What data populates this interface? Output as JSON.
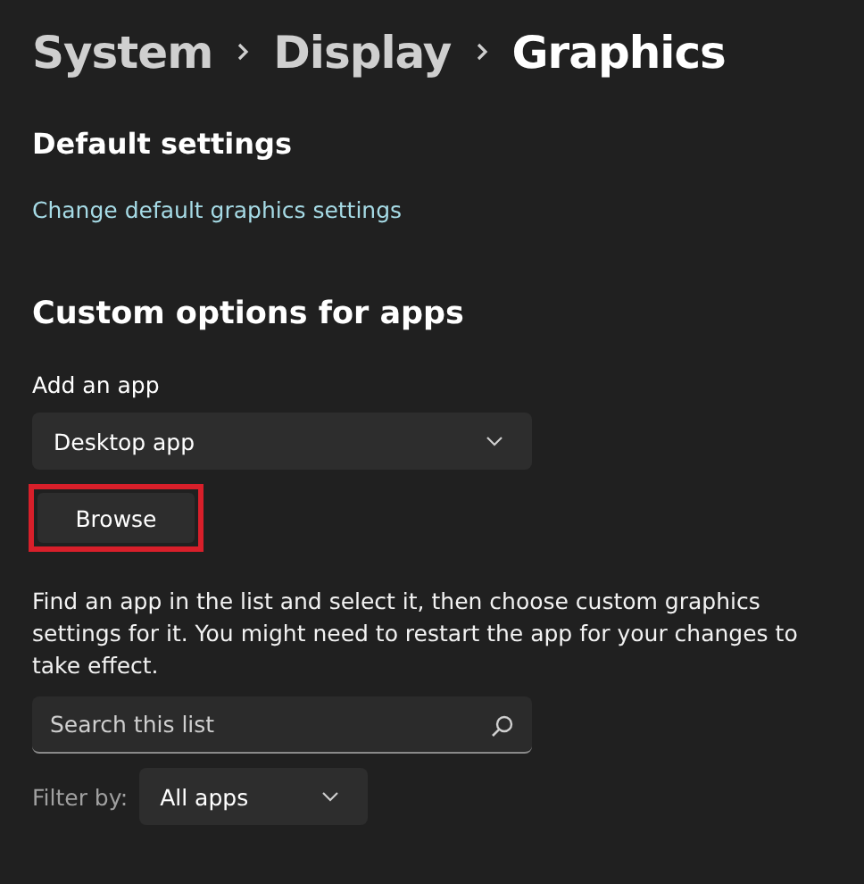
{
  "breadcrumb": [
    {
      "label": "System",
      "selected": false
    },
    {
      "label": "Display",
      "selected": false
    },
    {
      "label": "Graphics",
      "selected": true
    }
  ],
  "default_settings": {
    "heading": "Default settings",
    "link": "Change default graphics settings"
  },
  "custom_options": {
    "heading": "Custom options for apps",
    "add_label": "Add an app",
    "app_type": "Desktop app",
    "browse": {
      "label": "Browse",
      "highlighted": true
    },
    "description": "Find an app in the list and select it, then choose custom graphics settings for it. You might need to restart the app for your changes to take effect.",
    "search": {
      "placeholder": "Search this list"
    },
    "filter": {
      "label": "Filter by:",
      "value": "All apps"
    }
  }
}
